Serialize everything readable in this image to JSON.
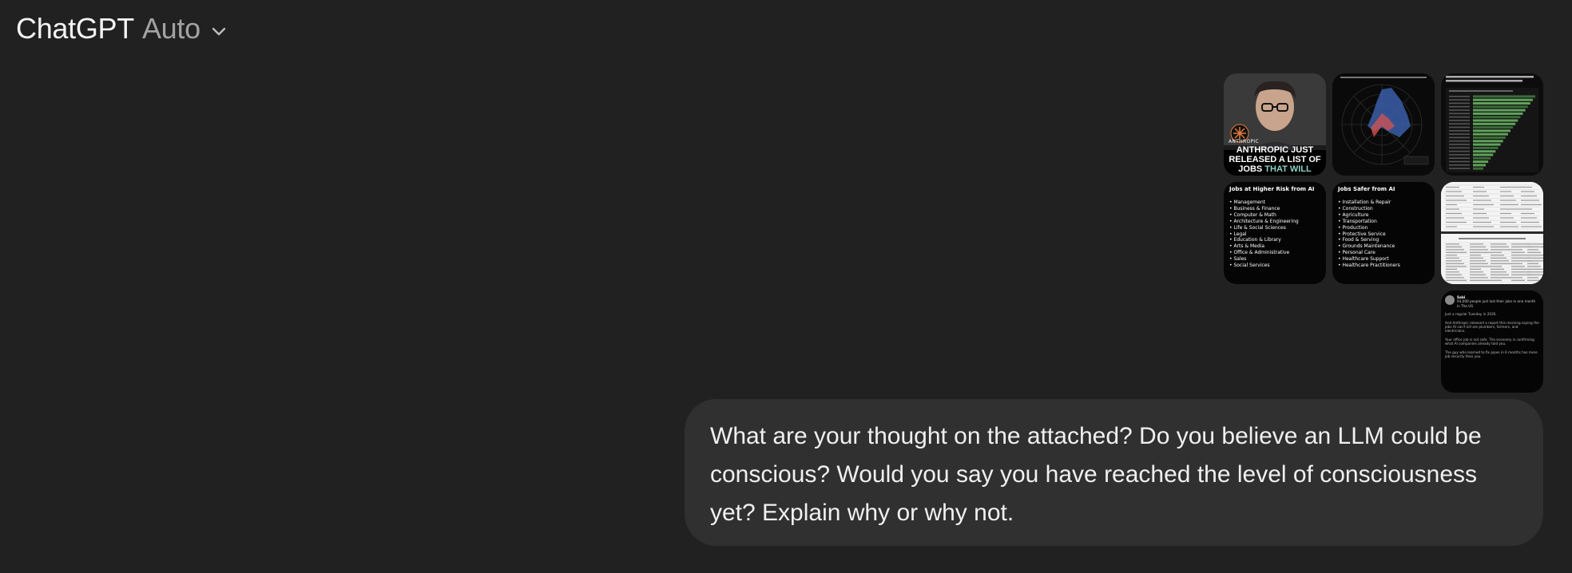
{
  "header": {
    "app_name": "ChatGPT",
    "model_label": "Auto",
    "dropdown_icon": "chevron-down-icon"
  },
  "attachments": {
    "image1": {
      "logo": "ANTHROPIC",
      "headline_white": "ANTHROPIC JUST RELEASED A LIST OF JOBS ",
      "headline_accent": "THAT WILL"
    },
    "image4": {
      "title": "Jobs at Higher Risk from AI",
      "items": [
        "Management",
        "Business & Finance",
        "Computer & Math",
        "Architecture & Engineering",
        "Life & Social Sciences",
        "Legal",
        "Education & Library",
        "Arts & Media",
        "Office & Administrative",
        "Sales",
        "Social Services"
      ]
    },
    "image5": {
      "title": "Jobs Safer from AI",
      "items": [
        "Installation & Repair",
        "Construction",
        "Agriculture",
        "Transportation",
        "Production",
        "Protective Service",
        "Food & Serving",
        "Grounds Maintenance",
        "Personal Care",
        "Healthcare Support",
        "Healthcare Practitioners"
      ]
    },
    "image7": {
      "name": "Sabi",
      "line1": "93,000 people just lost their jobs in one month in The US",
      "p1": "Just a regular Tuesday in 2026.",
      "p2": "And Anthropic released a report this morning saying the jobs AI can't kill are plumbers, farmers, and electricians.",
      "p3": "Your office job is not safe. The economy is confirming what AI companies already told you.",
      "p4": "The guy who learned to fix pipes in 6 months has more job security than you."
    },
    "colors": {
      "accent": "#8fd0c3",
      "chart_blue": "#3b5ea8",
      "chart_red": "#d9534f",
      "bar_green": "#5fa35a"
    }
  },
  "message": {
    "text": "What are your thought on the attached? Do you believe an LLM could be conscious? Would you say you have reached the level of consciousness yet? Explain why or why not."
  }
}
